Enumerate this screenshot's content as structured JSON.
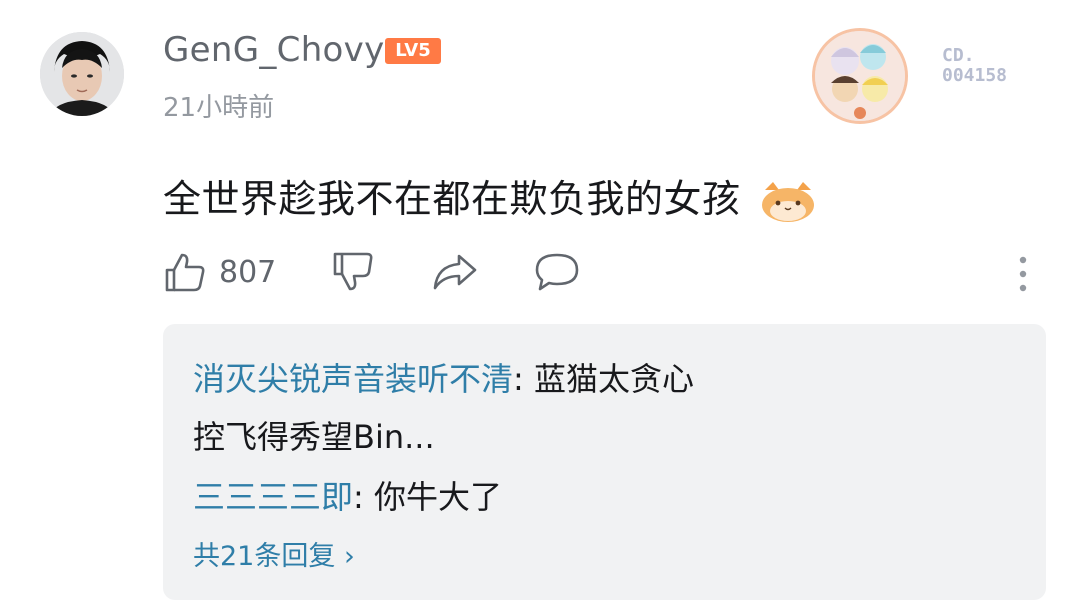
{
  "comment": {
    "username": "GenG_Chovy",
    "level_badge": "LV5",
    "time": "21小時前",
    "text": "全世界趁我不在都在欺负我的女孩",
    "decoration_number_line1": "CD.",
    "decoration_number_line2": "004158",
    "accent_color": "#2f7ea8"
  },
  "actions": {
    "like_count": "807",
    "like_icon": "thumbs-up-icon",
    "dislike_icon": "thumbs-down-icon",
    "share_icon": "share-icon",
    "reply_icon": "comment-icon",
    "more_icon": "more-vertical-icon"
  },
  "replies": {
    "items": [
      {
        "user": "消灭尖锐声音装听不清",
        "sep": ": ",
        "text_line1": "蓝猫太贪心",
        "text_line2": "控飞得秀望Bin..."
      },
      {
        "user": "三三三三即",
        "sep": ": ",
        "text_line1": "你牛大了"
      }
    ],
    "more_label": "共21条回复 ›"
  }
}
